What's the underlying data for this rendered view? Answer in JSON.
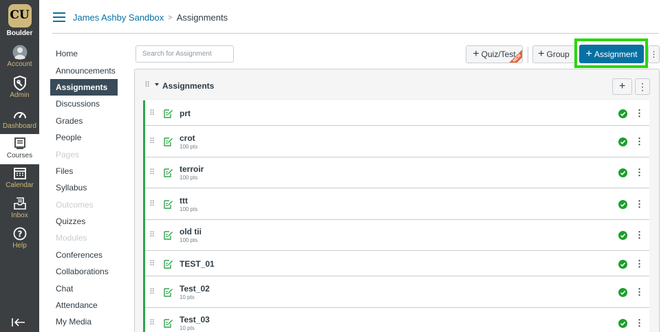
{
  "global_nav": {
    "logo_text": "Boulder",
    "items": [
      {
        "label": "Account",
        "icon": "account-icon"
      },
      {
        "label": "Admin",
        "icon": "admin-shield-icon"
      },
      {
        "label": "Dashboard",
        "icon": "dashboard-icon"
      },
      {
        "label": "Courses",
        "icon": "courses-icon",
        "active": true
      },
      {
        "label": "Calendar",
        "icon": "calendar-icon"
      },
      {
        "label": "Inbox",
        "icon": "inbox-icon"
      },
      {
        "label": "Help",
        "icon": "help-icon"
      }
    ],
    "accent": "#cfb87c",
    "background": "#3b3f42"
  },
  "breadcrumb": {
    "course": "James Ashby Sandbox",
    "separator": ">",
    "current": "Assignments"
  },
  "course_nav": [
    {
      "label": "Home",
      "state": "normal"
    },
    {
      "label": "Announcements",
      "state": "normal"
    },
    {
      "label": "Assignments",
      "state": "active"
    },
    {
      "label": "Discussions",
      "state": "normal"
    },
    {
      "label": "Grades",
      "state": "normal"
    },
    {
      "label": "People",
      "state": "normal"
    },
    {
      "label": "Pages",
      "state": "disabled"
    },
    {
      "label": "Files",
      "state": "normal"
    },
    {
      "label": "Syllabus",
      "state": "normal"
    },
    {
      "label": "Outcomes",
      "state": "disabled"
    },
    {
      "label": "Quizzes",
      "state": "normal"
    },
    {
      "label": "Modules",
      "state": "disabled"
    },
    {
      "label": "Conferences",
      "state": "normal"
    },
    {
      "label": "Collaborations",
      "state": "normal"
    },
    {
      "label": "Chat",
      "state": "normal"
    },
    {
      "label": "Attendance",
      "state": "normal"
    },
    {
      "label": "My Media",
      "state": "normal"
    }
  ],
  "toolbar": {
    "search_placeholder": "Search for Assignment",
    "quiz_label": "Quiz/Test",
    "new_badge": "NEW",
    "group_label": "Group",
    "assignment_label": "Assignment",
    "primary_color": "#0770a3",
    "highlight_color": "#2bd60e"
  },
  "group": {
    "title": "Assignments",
    "border_color": "#2da54b",
    "assignments": [
      {
        "name": "prt",
        "points": ""
      },
      {
        "name": "crot",
        "points": "100 pts"
      },
      {
        "name": "terroir",
        "points": "100 pts"
      },
      {
        "name": "ttt",
        "points": "100 pts"
      },
      {
        "name": "old tii",
        "points": "100 pts"
      },
      {
        "name": "TEST_01",
        "points": ""
      },
      {
        "name": "Test_02",
        "points": "10 pts"
      },
      {
        "name": "Test_03",
        "points": "10 pts"
      }
    ]
  }
}
